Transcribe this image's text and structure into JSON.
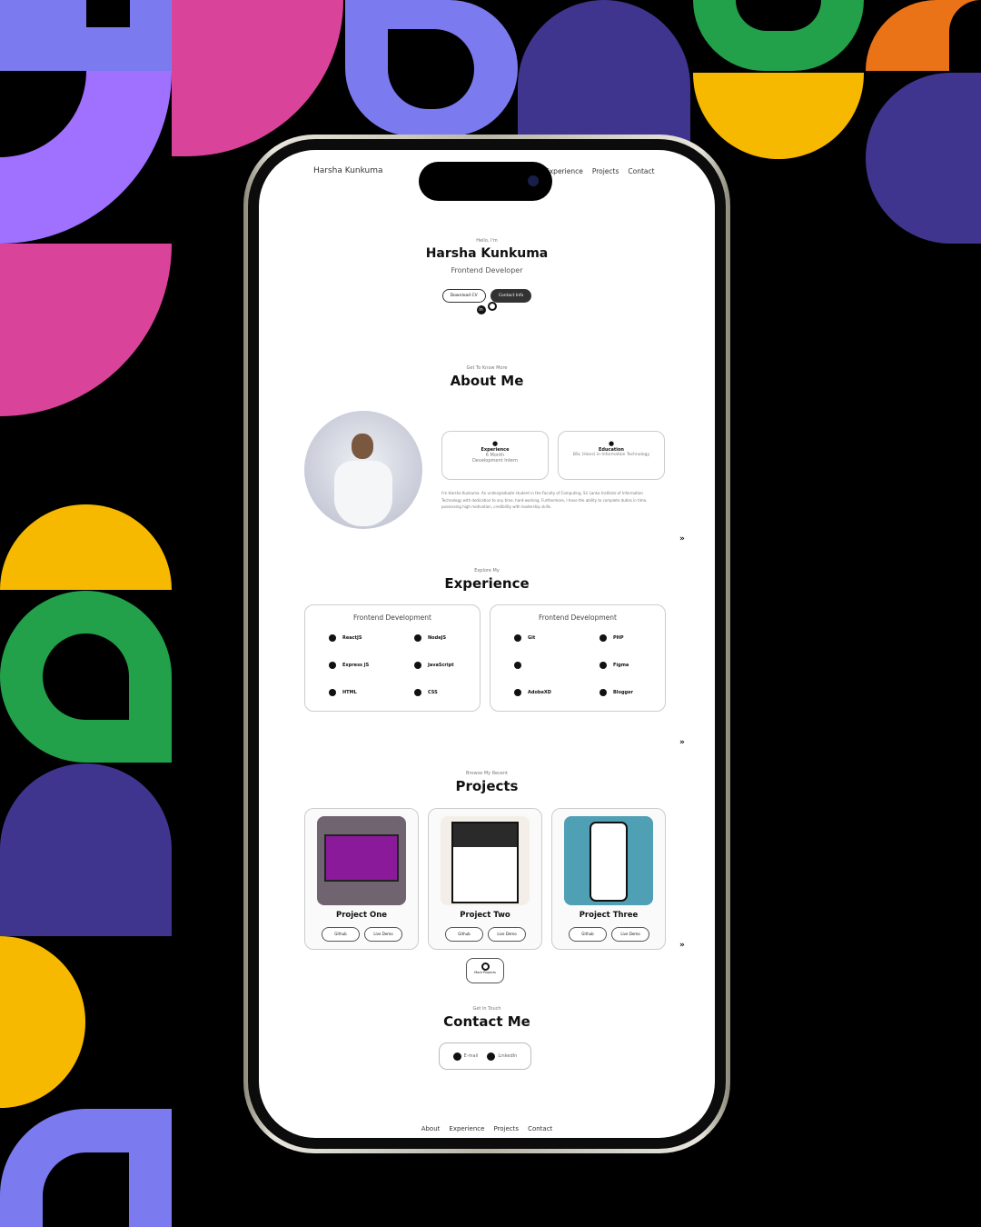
{
  "colors": {
    "lavender": "#7b7bef",
    "purple": "#a070ff",
    "pink": "#d9449a",
    "yellow": "#f6b900",
    "green": "#23a04a",
    "indigo": "#3f358f",
    "orange": "#ea7317"
  },
  "header": {
    "brand": "Harsha Kunkuma",
    "nav": [
      "Experience",
      "Projects",
      "Contact"
    ]
  },
  "hero": {
    "greeting": "Hello, I'm",
    "name": "Harsha Kunkuma",
    "role": "Frontend Developer",
    "buttons": [
      "Download CV",
      "Contact Info"
    ],
    "socials": [
      "linkedin-icon",
      "github-icon"
    ]
  },
  "about": {
    "kicker": "Get To Know More",
    "title": "About Me",
    "cards": [
      {
        "title": "Experience",
        "lines": [
          "6 Month",
          "Development Intern"
        ]
      },
      {
        "title": "Education",
        "lines": [
          "BSc (Hons) in Information Technology"
        ]
      }
    ],
    "text": "I'm Harsha Kunkuma. An undergraduate student in the Faculty of Computing, Sri Lanka Institute of Information Technology with dedication to any time, hard-working. Furthermore, I have the ability to complete duties in time, possessing high motivation, credibility with leadership skills."
  },
  "experience": {
    "kicker": "Explore My",
    "title": "Experience",
    "cards": [
      {
        "title": "Frontend Development",
        "skills": [
          "ReactJS",
          "NodeJS",
          "Express JS",
          "JavaScript",
          "HTML",
          "CSS"
        ]
      },
      {
        "title": "Frontend Development",
        "skills": [
          "Git",
          "PHP",
          "",
          "Figma",
          "AdobeXD",
          "Blogger"
        ]
      }
    ]
  },
  "projects": {
    "kicker": "Browse My Recent",
    "title": "Projects",
    "items": [
      {
        "title": "Project One",
        "buttons": [
          "Github",
          "Live Demo"
        ]
      },
      {
        "title": "Project Two",
        "buttons": [
          "Github",
          "Live Demo"
        ]
      },
      {
        "title": "Project Three",
        "buttons": [
          "Github",
          "Live Demo"
        ]
      }
    ],
    "more": "More Projects"
  },
  "contact": {
    "kicker": "Get In Touch",
    "title": "Contact Me",
    "email": "E-mail",
    "linkedin": "LinkedIn"
  },
  "footer": {
    "nav": [
      "About",
      "Experience",
      "Projects",
      "Contact"
    ]
  }
}
